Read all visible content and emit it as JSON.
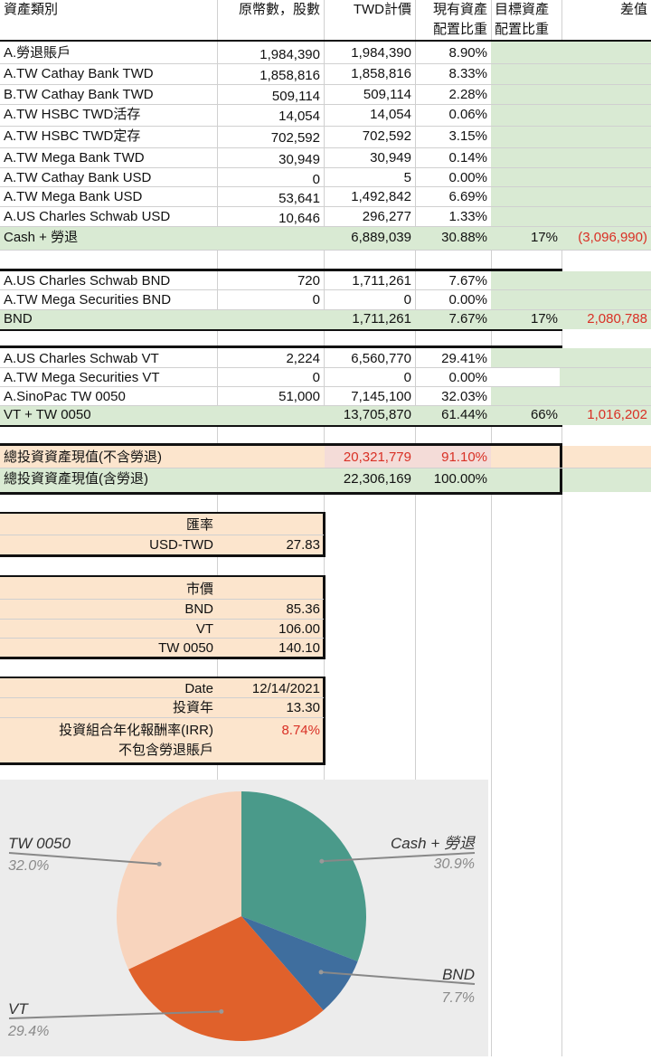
{
  "header": {
    "col_a": "資產類別",
    "col_b": "原幣數，股數",
    "col_c": "TWD計價",
    "col_d_line1": "現有資產",
    "col_d_line2": "配置比重",
    "col_e_line1": "目標資產",
    "col_e_line2": "配置比重",
    "col_f": "差值"
  },
  "cash_rows": [
    {
      "name": "A.勞退賬戶",
      "qty": "1,984,390",
      "twd": "1,984,390",
      "pct": "8.90%"
    },
    {
      "name": "A.TW Cathay Bank TWD",
      "qty": "1,858,816",
      "twd": "1,858,816",
      "pct": "8.33%"
    },
    {
      "name": "B.TW Cathay Bank TWD",
      "qty": "509,114",
      "twd": "509,114",
      "pct": "2.28%"
    },
    {
      "name": "A.TW HSBC TWD活存",
      "qty": "14,054",
      "twd": "14,054",
      "pct": "0.06%"
    },
    {
      "name": "A.TW HSBC TWD定存",
      "qty": "702,592",
      "twd": "702,592",
      "pct": "3.15%"
    },
    {
      "name": "A.TW Mega Bank TWD",
      "qty": "30,949",
      "twd": "30,949",
      "pct": "0.14%"
    },
    {
      "name": "A.TW Cathay Bank USD",
      "qty": "0",
      "twd": "5",
      "pct": "0.00%"
    },
    {
      "name": "A.TW Mega Bank USD",
      "qty": "53,641",
      "twd": "1,492,842",
      "pct": "6.69%"
    },
    {
      "name": "A.US Charles Schwab USD",
      "qty": "10,646",
      "twd": "296,277",
      "pct": "1.33%"
    }
  ],
  "cash_total": {
    "name": "Cash + 勞退",
    "twd": "6,889,039",
    "pct": "30.88%",
    "target": "17%",
    "diff": "(3,096,990)"
  },
  "bnd_rows": [
    {
      "name": "A.US Charles Schwab BND",
      "qty": "720",
      "twd": "1,711,261",
      "pct": "7.67%"
    },
    {
      "name": "A.TW Mega Securities BND",
      "qty": "0",
      "twd": "0",
      "pct": "0.00%"
    }
  ],
  "bnd_total": {
    "name": "BND",
    "twd": "1,711,261",
    "pct": "7.67%",
    "target": "17%",
    "diff": "2,080,788"
  },
  "vt_rows": [
    {
      "name": "A.US Charles Schwab VT",
      "qty": "2,224",
      "twd": "6,560,770",
      "pct": "29.41%"
    },
    {
      "name": "A.TW Mega Securities VT",
      "qty": "0",
      "twd": "0",
      "pct": "0.00%"
    },
    {
      "name": "A.SinoPac TW 0050",
      "qty": "51,000",
      "twd": "7,145,100",
      "pct": "32.03%"
    }
  ],
  "vt_total": {
    "name": "VT + TW 0050",
    "twd": "13,705,870",
    "pct": "61.44%",
    "target": "66%",
    "diff": "1,016,202"
  },
  "summary": [
    {
      "name": "總投資資產現值(不含勞退)",
      "twd": "20,321,779",
      "pct": "91.10%"
    },
    {
      "name": "總投資資產現值(含勞退)",
      "twd": "22,306,169",
      "pct": "100.00%"
    }
  ],
  "fx": {
    "title": "匯率",
    "label": "USD-TWD",
    "value": "27.83"
  },
  "prices": {
    "title": "市價",
    "items": [
      {
        "label": "BND",
        "value": "85.36"
      },
      {
        "label": "VT",
        "value": "106.00"
      },
      {
        "label": "TW 0050",
        "value": "140.10"
      }
    ]
  },
  "stats": {
    "date_label": "Date",
    "date_value": "12/14/2021",
    "years_label": "投資年",
    "years_value": "13.30",
    "irr_label_line1": "投資組合年化報酬率(IRR)",
    "irr_label_line2": "不包含勞退賬戶",
    "irr_value": "8.74%"
  },
  "chart_data": {
    "type": "pie",
    "labels": [
      "Cash + 勞退",
      "BND",
      "VT",
      "TW 0050"
    ],
    "values": [
      30.9,
      7.7,
      29.4,
      32.0
    ],
    "display": [
      "30.9%",
      "7.7%",
      "29.4%",
      "32.0%"
    ],
    "colors": [
      "#4a9a8a",
      "#3f6e9e",
      "#e0612b",
      "#f8d4bd"
    ]
  }
}
